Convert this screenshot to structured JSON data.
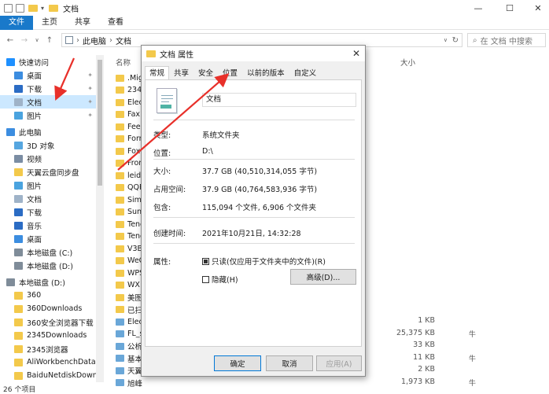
{
  "window": {
    "title": "文档",
    "minimize": "—",
    "maximize": "☐",
    "close": "✕"
  },
  "ribbon": {
    "tabs": [
      "文件",
      "主页",
      "共享",
      "查看"
    ]
  },
  "address": {
    "path_root": "此电脑",
    "path_current": "文档",
    "search_placeholder": "在 文档 中搜索"
  },
  "sidebar": {
    "items": [
      {
        "label": "快速访问",
        "icon": "star-icon",
        "color": "#1e90ff"
      },
      {
        "label": "桌面",
        "icon": "desktop-icon",
        "color": "#3c8de0",
        "pinned": true
      },
      {
        "label": "下载",
        "icon": "download-icon",
        "color": "#2b6cc4",
        "pinned": true
      },
      {
        "label": "文档",
        "icon": "document-icon",
        "color": "#9fb3c8",
        "pinned": true,
        "selected": true
      },
      {
        "label": "图片",
        "icon": "picture-icon",
        "color": "#4aa3df",
        "pinned": true
      },
      {
        "label": "此电脑",
        "icon": "computer-icon",
        "color": "#3c8de0"
      },
      {
        "label": "3D 对象",
        "icon": "cube-icon",
        "color": "#56a6e0"
      },
      {
        "label": "视频",
        "icon": "video-icon",
        "color": "#7b8da3"
      },
      {
        "label": "天翼云盘同步盘",
        "icon": "folder-icon",
        "color": "#f3c94b"
      },
      {
        "label": "图片",
        "icon": "picture-icon",
        "color": "#4aa3df"
      },
      {
        "label": "文档",
        "icon": "document-icon",
        "color": "#9fb3c8"
      },
      {
        "label": "下载",
        "icon": "download-icon",
        "color": "#2b6cc4"
      },
      {
        "label": "音乐",
        "icon": "music-icon",
        "color": "#2b6cc4"
      },
      {
        "label": "桌面",
        "icon": "desktop-icon",
        "color": "#3c8de0"
      },
      {
        "label": "本地磁盘 (C:)",
        "icon": "drive-icon",
        "color": "#7f8c99"
      },
      {
        "label": "本地磁盘 (D:)",
        "icon": "drive-icon",
        "color": "#7f8c99"
      },
      {
        "label": "本地磁盘 (D:)",
        "icon": "drive-icon",
        "color": "#7f8c99"
      },
      {
        "label": "360",
        "icon": "folder-icon",
        "color": "#f3c94b"
      },
      {
        "label": "360Downloads",
        "icon": "folder-icon",
        "color": "#f3c94b"
      },
      {
        "label": "360安全浏览器下载",
        "icon": "folder-icon",
        "color": "#f3c94b"
      },
      {
        "label": "2345Downloads",
        "icon": "folder-icon",
        "color": "#f3c94b"
      },
      {
        "label": "2345浏览器",
        "icon": "folder-icon",
        "color": "#f3c94b"
      },
      {
        "label": "AliWorkbenchData",
        "icon": "folder-icon",
        "color": "#f3c94b"
      },
      {
        "label": "BaiduNetdiskDownloa",
        "icon": "folder-icon",
        "color": "#f3c94b"
      }
    ]
  },
  "filelist": {
    "col_name": "名称",
    "col_size": "大小",
    "rows": [
      {
        "name": ".Mig",
        "size": "",
        "type": ""
      },
      {
        "name": "2345",
        "size": "",
        "type": ""
      },
      {
        "name": "Elec",
        "size": "",
        "type": ""
      },
      {
        "name": "Fax",
        "size": "",
        "type": ""
      },
      {
        "name": "Feed",
        "size": "",
        "type": ""
      },
      {
        "name": "Form",
        "size": "",
        "type": ""
      },
      {
        "name": "Foxit",
        "size": "",
        "type": ""
      },
      {
        "name": "Fron",
        "size": "",
        "type": ""
      },
      {
        "name": "leidi",
        "size": "",
        "type": ""
      },
      {
        "name": "QQP",
        "size": "",
        "type": ""
      },
      {
        "name": "Simp",
        "size": "",
        "type": ""
      },
      {
        "name": "Sunl",
        "size": "",
        "type": ""
      },
      {
        "name": "Tenc",
        "size": "",
        "type": ""
      },
      {
        "name": "Tenc",
        "size": "",
        "type": ""
      },
      {
        "name": "V3B",
        "size": "",
        "type": ""
      },
      {
        "name": "WeC",
        "size": "",
        "type": ""
      },
      {
        "name": "WPS",
        "size": "",
        "type": ""
      },
      {
        "name": "WX",
        "size": "",
        "type": ""
      },
      {
        "name": "美图",
        "size": "",
        "type": ""
      },
      {
        "name": "已扫",
        "size": "",
        "type": ""
      },
      {
        "name": "Elec",
        "size": "1 KB",
        "type": ""
      },
      {
        "name": "FL_s",
        "size": "25,375 KB",
        "type": "牛"
      },
      {
        "name": "公析",
        "size": "33 KB",
        "type": ""
      },
      {
        "name": "基本",
        "size": "11 KB",
        "type": "牛"
      },
      {
        "name": "天翼",
        "size": "2 KB",
        "type": ""
      },
      {
        "name": "旭峰",
        "size": "1,973 KB",
        "type": "牛"
      }
    ]
  },
  "status": {
    "count": "26 个项目"
  },
  "dialog": {
    "title": "文档 属性",
    "close": "✕",
    "tabs": [
      "常规",
      "共享",
      "安全",
      "位置",
      "以前的版本",
      "自定义"
    ],
    "name_value": "文档",
    "fields": [
      {
        "label": "类型:",
        "value": "系统文件夹"
      },
      {
        "label": "位置:",
        "value": "D:\\"
      },
      {
        "label": "大小:",
        "value": "37.7 GB (40,510,314,055 字节)"
      },
      {
        "label": "占用空间:",
        "value": "37.9 GB (40,764,583,936 字节)"
      },
      {
        "label": "包含:",
        "value": "115,094 个文件, 6,906 个文件夹"
      },
      {
        "label": "创建时间:",
        "value": "2021年10月21日, 14:32:28"
      },
      {
        "label": "属性:",
        "value": ""
      }
    ],
    "readonly_label": "只读(仅应用于文件夹中的文件)(R)",
    "hidden_label": "隐藏(H)",
    "advanced_label": "高级(D)...",
    "ok_label": "确定",
    "cancel_label": "取消",
    "apply_label": "应用(A)"
  },
  "accent": {
    "file_tab": "#1979ca",
    "selection": "#cce8ff",
    "annotation": "#e8302a"
  }
}
